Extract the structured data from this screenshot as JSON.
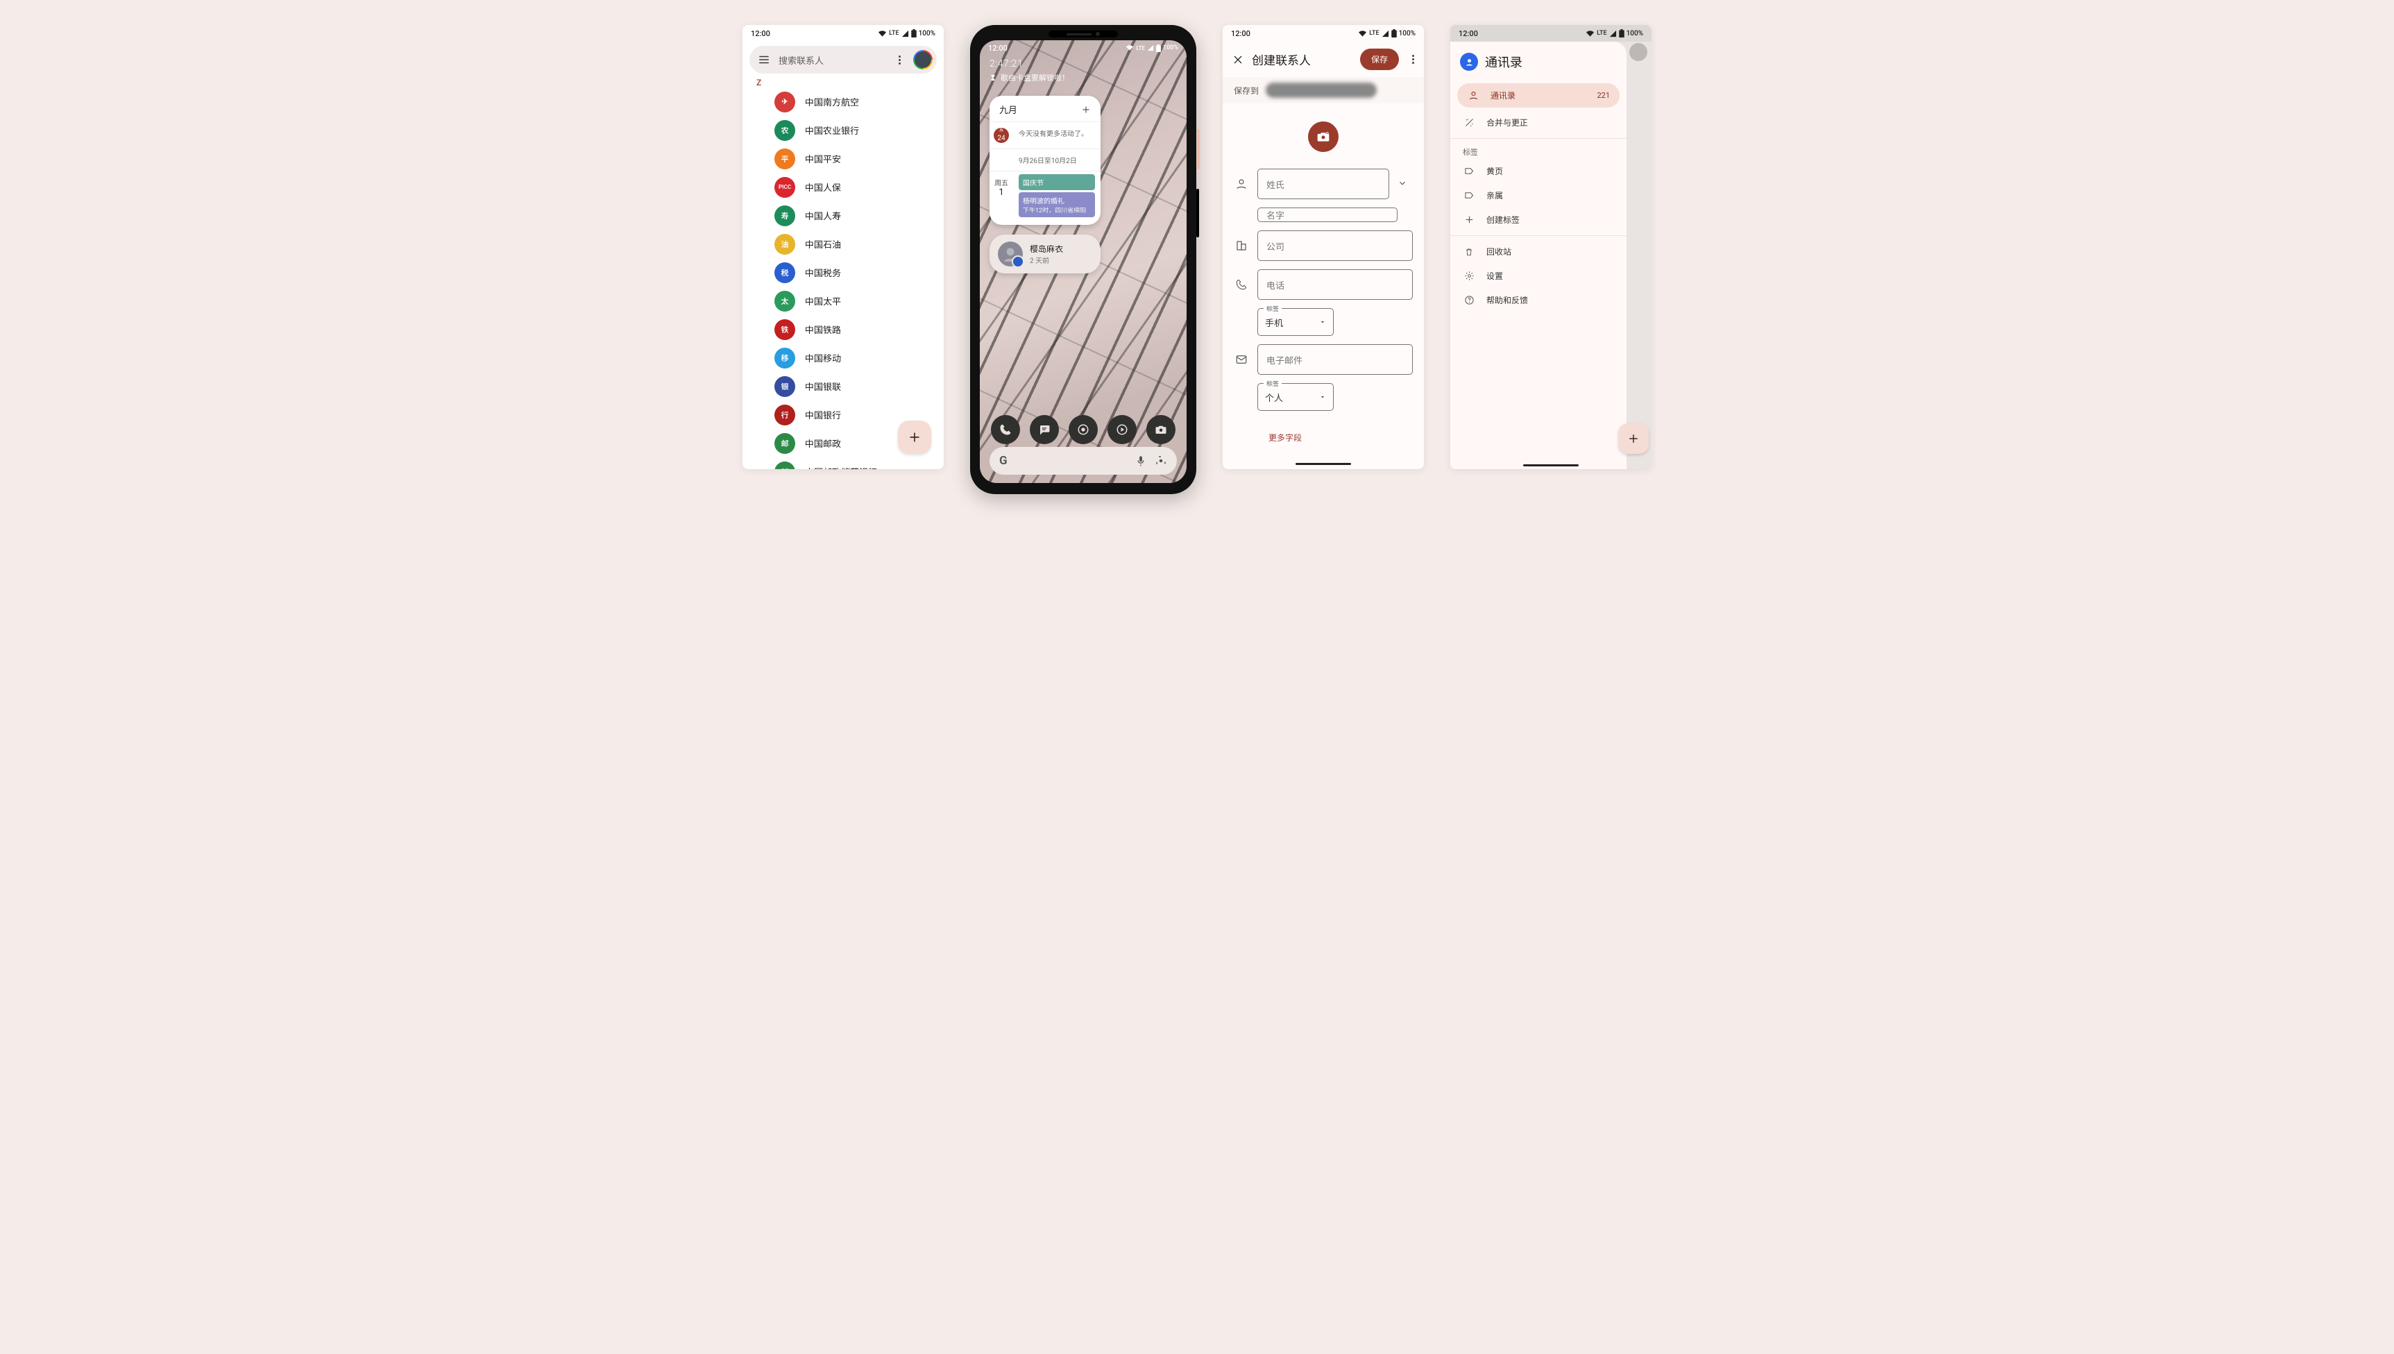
{
  "status": {
    "time": "12:00",
    "net": "LTE",
    "battery": "100%"
  },
  "screen1": {
    "search_placeholder": "搜索联系人",
    "index_letter": "Z",
    "contacts": [
      {
        "name": "中国南方航空",
        "bg": "#d43d3a",
        "short": "✈"
      },
      {
        "name": "中国农业银行",
        "bg": "#1a8a5a",
        "short": "农"
      },
      {
        "name": "中国平安",
        "bg": "#f07a1e",
        "short": "平"
      },
      {
        "name": "中国人保",
        "bg": "#d9272e",
        "short": "PICC"
      },
      {
        "name": "中国人寿",
        "bg": "#1e8c5a",
        "short": "寿"
      },
      {
        "name": "中国石油",
        "bg": "#e8b42a",
        "short": "油"
      },
      {
        "name": "中国税务",
        "bg": "#2a5fd0",
        "short": "税"
      },
      {
        "name": "中国太平",
        "bg": "#2c9a5a",
        "short": "太"
      },
      {
        "name": "中国铁路",
        "bg": "#c4201f",
        "short": "铁"
      },
      {
        "name": "中国移动",
        "bg": "#2a9de0",
        "short": "移"
      },
      {
        "name": "中国银联",
        "bg": "#344da0",
        "short": "银"
      },
      {
        "name": "中国银行",
        "bg": "#b0201d",
        "short": "行"
      },
      {
        "name": "中国邮政",
        "bg": "#2c8a47",
        "short": "邮"
      },
      {
        "name": "中国邮政储蓄银行",
        "bg": "#2c8a47",
        "short": "储"
      }
    ]
  },
  "screen2": {
    "clock": "2:47:21",
    "countdown": "歌曲卡盒要解锁啦！",
    "cal": {
      "month": "九月",
      "today_wk": "五",
      "today_day": "24",
      "today_text": "今天没有更多活动了。",
      "range": "9月26日至10月2日",
      "fri_wk": "周五",
      "fri_day": "1",
      "event1": "国庆节",
      "event2_title": "杨明波的婚礼",
      "event2_sub": "下午12时，四川省绵阳"
    },
    "msg": {
      "name": "樱岛麻衣",
      "time": "2 天前"
    }
  },
  "screen3": {
    "title": "创建联系人",
    "save": "保存",
    "save_to": "保存到",
    "f_surname": "姓氏",
    "f_given": "名字",
    "f_company": "公司",
    "f_phone": "电话",
    "l_label": "标签",
    "v_phone_label": "手机",
    "f_email": "电子邮件",
    "v_email_label": "个人",
    "more": "更多字段"
  },
  "screen4": {
    "title": "通讯录",
    "row_contacts": "通讯录",
    "row_contacts_count": "221",
    "row_merge": "合并与更正",
    "sec_labels": "标签",
    "row_yellow": "黄页",
    "row_relatives": "亲属",
    "row_create": "创建标签",
    "row_trash": "回收站",
    "row_settings": "设置",
    "row_help": "帮助和反馈"
  }
}
